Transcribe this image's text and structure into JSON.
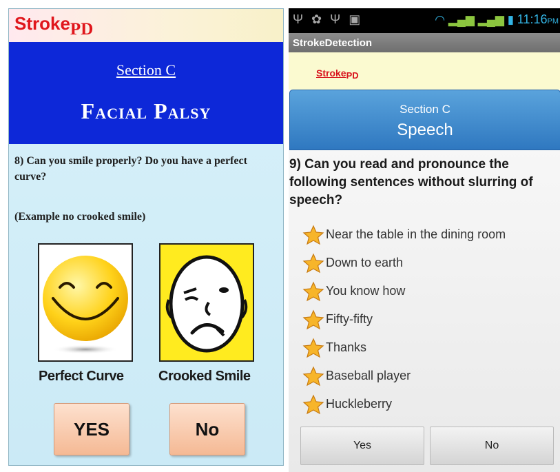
{
  "left_screen": {
    "logo": {
      "part1": "Stroke",
      "part2": "PD"
    },
    "section_label": "Section C",
    "section_title": "Facial Palsy",
    "question": "8) Can you smile properly? Do you have a perfect curve?",
    "note": "(Example no crooked smile)",
    "images": [
      {
        "icon": "smiley-face-icon",
        "caption": "Perfect Curve"
      },
      {
        "icon": "crooked-face-icon",
        "caption": "Crooked Smile"
      }
    ],
    "buttons": {
      "yes": "YES",
      "no": "No"
    },
    "colors": {
      "banner": "#0d28d8",
      "logo": "#e0161c",
      "button": "#f5b994"
    }
  },
  "right_screen": {
    "status_bar": {
      "time": "11:16",
      "ampm": "PM"
    },
    "app_title": "StrokeDetection",
    "logo": {
      "part1": "Stroke",
      "part2": "PD"
    },
    "section_label": "Section C",
    "section_title": "Speech",
    "question": "9) Can you read and pronounce the following sentences without slurring of speech?",
    "options": [
      {
        "icon": "star-icon",
        "label": "Near the table in the dining room"
      },
      {
        "icon": "star-icon",
        "label": "Down to earth"
      },
      {
        "icon": "star-icon",
        "label": "You know how"
      },
      {
        "icon": "star-icon",
        "label": "Fifty-fifty"
      },
      {
        "icon": "star-icon",
        "label": "Thanks"
      },
      {
        "icon": "star-icon",
        "label": "Baseball player"
      },
      {
        "icon": "star-icon",
        "label": "Huckleberry"
      }
    ],
    "buttons": {
      "yes": "Yes",
      "no": "No"
    },
    "colors": {
      "section_panel": "#3a86cc",
      "logo_bar": "#fbfad0"
    }
  }
}
